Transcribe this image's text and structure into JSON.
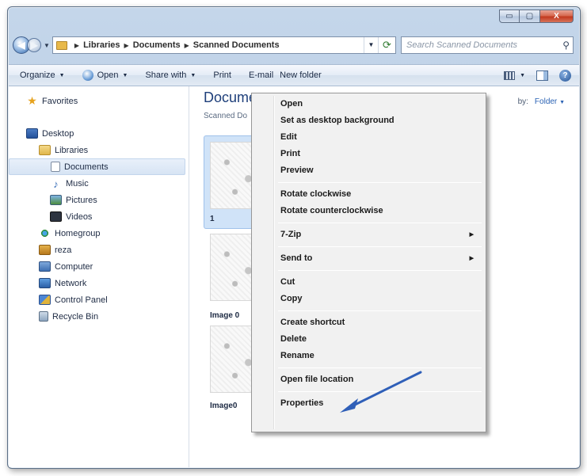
{
  "window": {
    "minimize_glyph": "▭",
    "maximize_glyph": "▢",
    "close_glyph": "X"
  },
  "address": {
    "crumbs": [
      "Libraries",
      "Documents",
      "Scanned Documents"
    ],
    "search_placeholder": "Search Scanned Documents"
  },
  "toolbar": {
    "organize": "Organize",
    "open": "Open",
    "share_with": "Share with",
    "print": "Print",
    "email": "E-mail",
    "new_folder": "New folder"
  },
  "nav": {
    "favorites": "Favorites",
    "desktop": "Desktop",
    "libraries": "Libraries",
    "documents": "Documents",
    "music": "Music",
    "pictures": "Pictures",
    "videos": "Videos",
    "homegroup": "Homegroup",
    "user": "reza",
    "computer": "Computer",
    "network": "Network",
    "control_panel": "Control Panel",
    "recycle_bin": "Recycle Bin"
  },
  "folder": {
    "title": "Docume",
    "subtitle": "Scanned Do",
    "arrange_label": "by:",
    "arrange_value": "Folder"
  },
  "files": [
    {
      "label": "1"
    },
    {
      "label": "Image 0"
    },
    {
      "label": "Image0"
    }
  ],
  "context_menu": {
    "open": "Open",
    "set_background": "Set as desktop background",
    "edit": "Edit",
    "print": "Print",
    "preview": "Preview",
    "rotate_cw": "Rotate clockwise",
    "rotate_ccw": "Rotate counterclockwise",
    "zip": "7-Zip",
    "send_to": "Send to",
    "cut": "Cut",
    "copy": "Copy",
    "create_shortcut": "Create shortcut",
    "delete": "Delete",
    "rename": "Rename",
    "open_location": "Open file location",
    "properties": "Properties"
  },
  "annotation_color": "#2f5fb8"
}
